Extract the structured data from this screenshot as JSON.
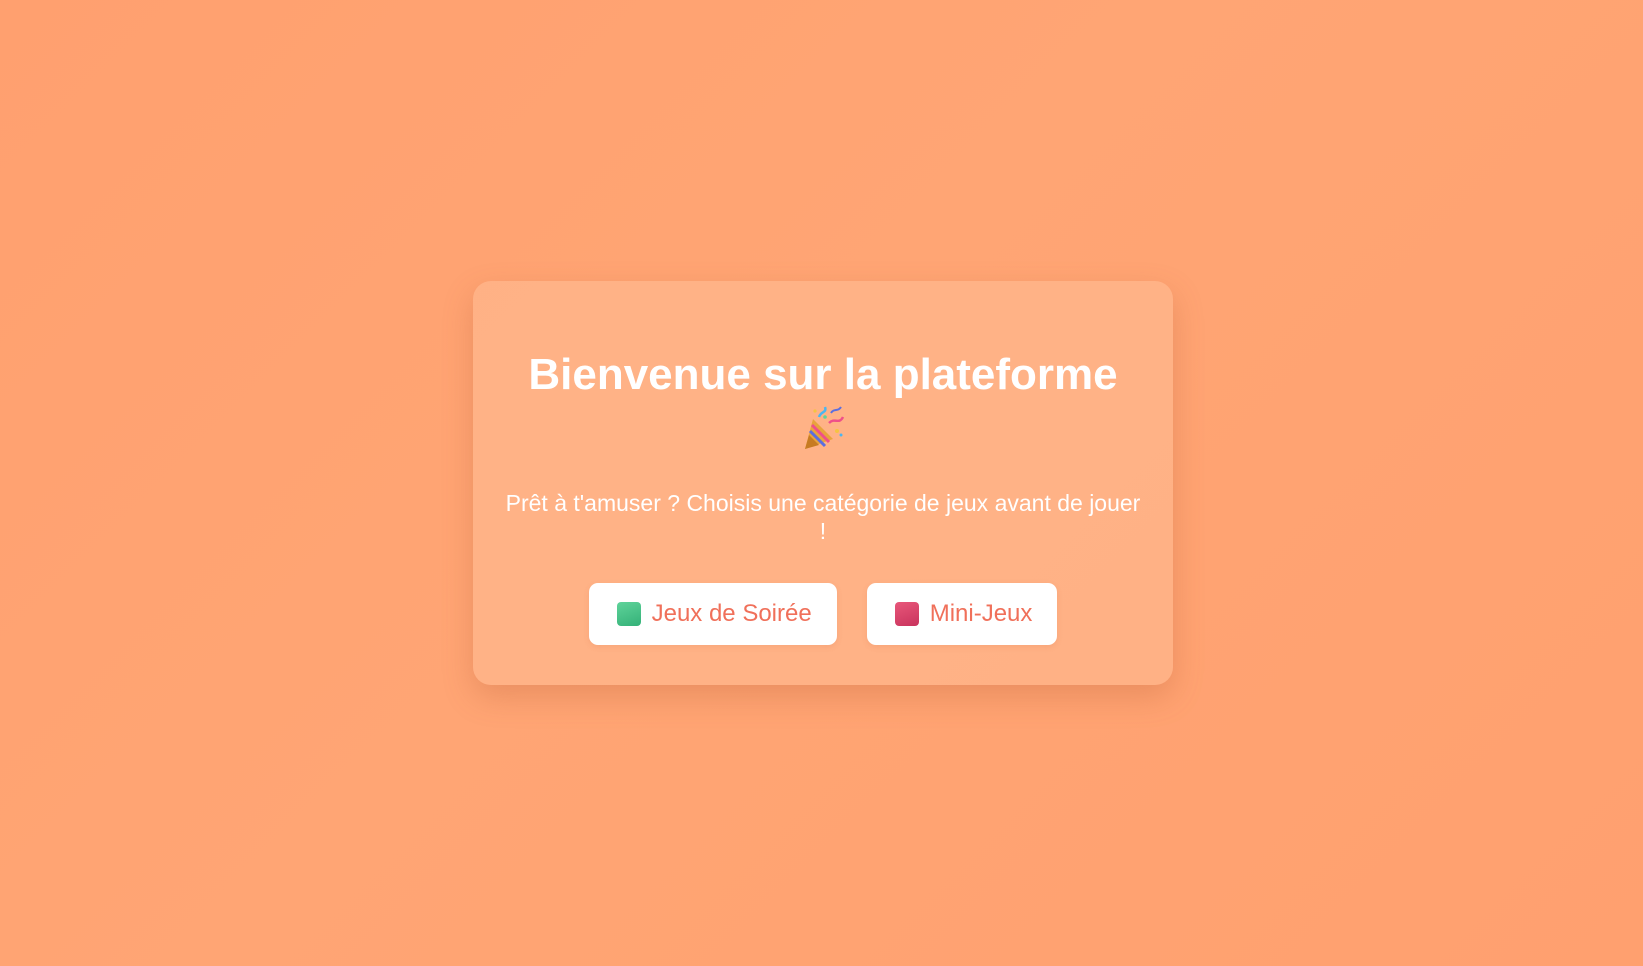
{
  "welcome": {
    "title": "Bienvenue sur la plateforme",
    "title_icon": "party-popper-icon",
    "subtitle": "Prêt à t'amuser ? Choisis une catégorie de jeux avant de jouer !"
  },
  "categories": [
    {
      "label": "Jeux de Soirée",
      "icon": "green-square-icon",
      "color": "#3fc488"
    },
    {
      "label": "Mini-Jeux",
      "icon": "pink-square-icon",
      "color": "#d94068"
    }
  ],
  "colors": {
    "background": "#ffa06f",
    "button_text": "#f0705a",
    "text": "#ffffff"
  }
}
